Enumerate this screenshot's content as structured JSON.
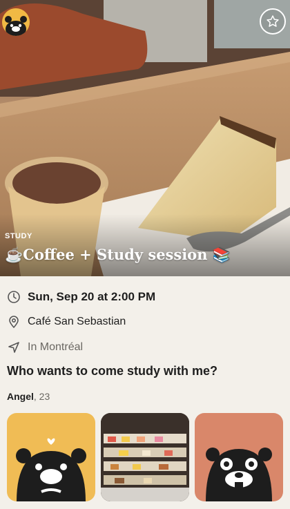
{
  "event": {
    "category": "STUDY",
    "title": "☕Coffee + Study session 📚",
    "date": "Sun, Sep 20 at 2:00 PM",
    "place": "Café San Sebastian",
    "city": "In Montréal",
    "question": "Who wants to come study with me?"
  },
  "host": {
    "name": "Angel",
    "age": ", 23"
  },
  "icons": {
    "avatar": "bear-avatar-icon",
    "favorite": "star-icon",
    "date": "clock-icon",
    "place": "map-pin-icon",
    "city": "location-arrow-icon"
  },
  "colors": {
    "avatar_bg": "#f1b944",
    "thumb1_bg": "#f0bc55",
    "thumb3_bg": "#d9876a",
    "page_bg": "#f3f0ea"
  }
}
